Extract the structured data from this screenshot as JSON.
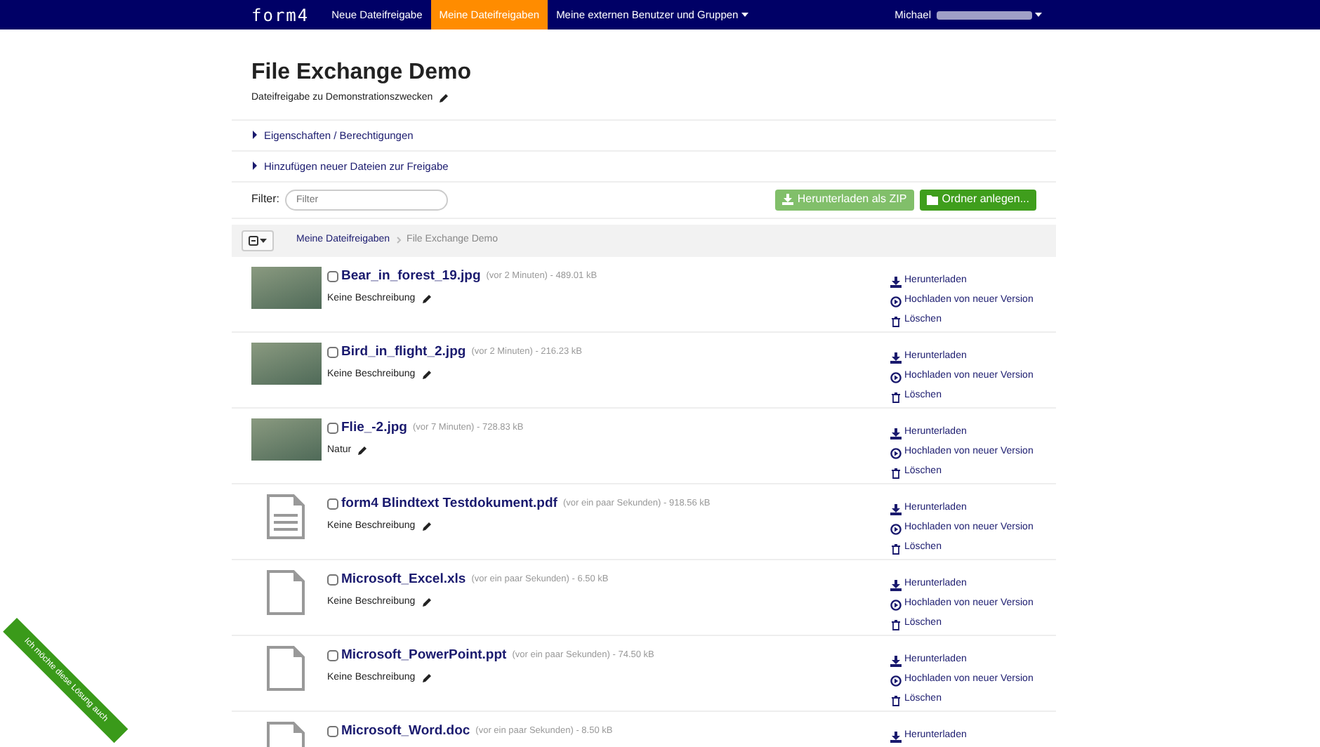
{
  "navbar": {
    "brand": "form4",
    "links": [
      {
        "label": "Neue Dateifreigabe",
        "selected": false,
        "dropdown": false
      },
      {
        "label": "Meine Dateifreigaben",
        "selected": true,
        "dropdown": false
      },
      {
        "label": "Meine externen Benutzer und Gruppen",
        "selected": false,
        "dropdown": true
      }
    ],
    "user": "Michael"
  },
  "header": {
    "title": "File Exchange Demo",
    "description": "Dateifreigabe zu Demonstrationszwecken"
  },
  "sections": [
    {
      "label": "Eigenschaften / Berechtigungen",
      "expanded": false
    },
    {
      "label": "Hinzufügen neuer Dateien zur Freigabe",
      "expanded": false
    }
  ],
  "filter": {
    "label": "Filter:",
    "placeholder": "Filter"
  },
  "buttons": [
    {
      "label": "Herunterladen als ZIP",
      "kind": "download",
      "disabled": true
    },
    {
      "label": "Ordner anlegen...",
      "kind": "folder",
      "disabled": false
    }
  ],
  "breadcrumb": [
    {
      "label": "Meine Dateifreigaben",
      "selected": false
    },
    {
      "label": "File Exchange Demo",
      "selected": true
    }
  ],
  "files": [
    {
      "kind": "photo",
      "name": "Bear_in_forest_19.jpg",
      "meta": "(vor 2 Minuten) - 489.01 kB",
      "description": "Keine Beschreibung",
      "checked": false,
      "actions": [
        "Herunterladen",
        "Hochladen von neuer Version",
        "Löschen"
      ]
    },
    {
      "kind": "photo",
      "name": "Bird_in_flight_2.jpg",
      "meta": "(vor 2 Minuten) - 216.23 kB",
      "description": "Keine Beschreibung",
      "checked": false,
      "actions": [
        "Herunterladen",
        "Hochladen von neuer Version",
        "Löschen"
      ]
    },
    {
      "kind": "photo",
      "name": "Flie_-2.jpg",
      "meta": "(vor 7 Minuten) - 728.83 kB",
      "description": "Natur",
      "checked": false,
      "actions": [
        "Herunterladen",
        "Hochladen von neuer Version",
        "Löschen"
      ]
    },
    {
      "kind": "text",
      "name": "form4 Blindtext Testdokument.pdf",
      "meta": "(vor ein paar Sekunden) - 918.56 kB",
      "description": "Keine Beschreibung",
      "checked": false,
      "actions": [
        "Herunterladen",
        "Hochladen von neuer Version",
        "Löschen"
      ]
    },
    {
      "kind": "blank",
      "name": "Microsoft_Excel.xls",
      "meta": "(vor ein paar Sekunden) - 6.50 kB",
      "description": "Keine Beschreibung",
      "checked": false,
      "actions": [
        "Herunterladen",
        "Hochladen von neuer Version",
        "Löschen"
      ]
    },
    {
      "kind": "blank",
      "name": "Microsoft_PowerPoint.ppt",
      "meta": "(vor ein paar Sekunden) - 74.50 kB",
      "description": "Keine Beschreibung",
      "checked": false,
      "actions": [
        "Herunterladen",
        "Hochladen von neuer Version",
        "Löschen"
      ]
    },
    {
      "kind": "blank",
      "name": "Microsoft_Word.doc",
      "meta": "(vor ein paar Sekunden) - 8.50 kB",
      "checked": false,
      "actions": [
        "Herunterladen"
      ]
    }
  ],
  "ribbon": "Ich möchte diese Lösung auch"
}
